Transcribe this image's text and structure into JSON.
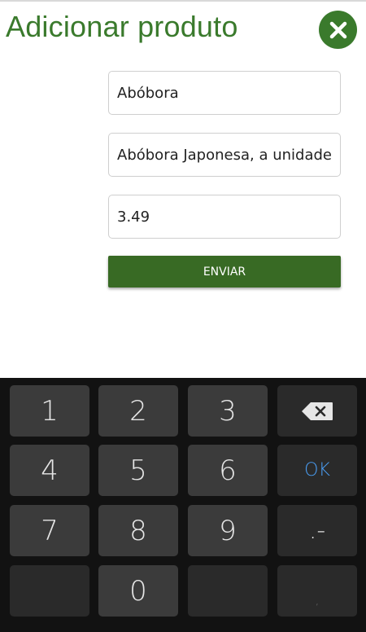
{
  "header": {
    "title": "Adicionar produto",
    "close_icon": "close-icon",
    "accent_color": "#3a7a2c"
  },
  "form": {
    "name_value": "Abóbora",
    "description_value": "Abóbora Japonesa, a unidade",
    "price_value": "3.49",
    "submit_label": "ENVIAR"
  },
  "keyboard": {
    "keys": {
      "k1": "1",
      "k2": "2",
      "k3": "3",
      "backspace_icon": "backspace-icon",
      "k4": "4",
      "k5": "5",
      "k6": "6",
      "ok": "OK",
      "k7": "7",
      "k8": "8",
      "k9": "9",
      "dot_dash": ".-",
      "blank_left": "",
      "k0": "0",
      "blank_mid": "",
      "comma": ","
    },
    "ok_color": "#4a9df2"
  }
}
